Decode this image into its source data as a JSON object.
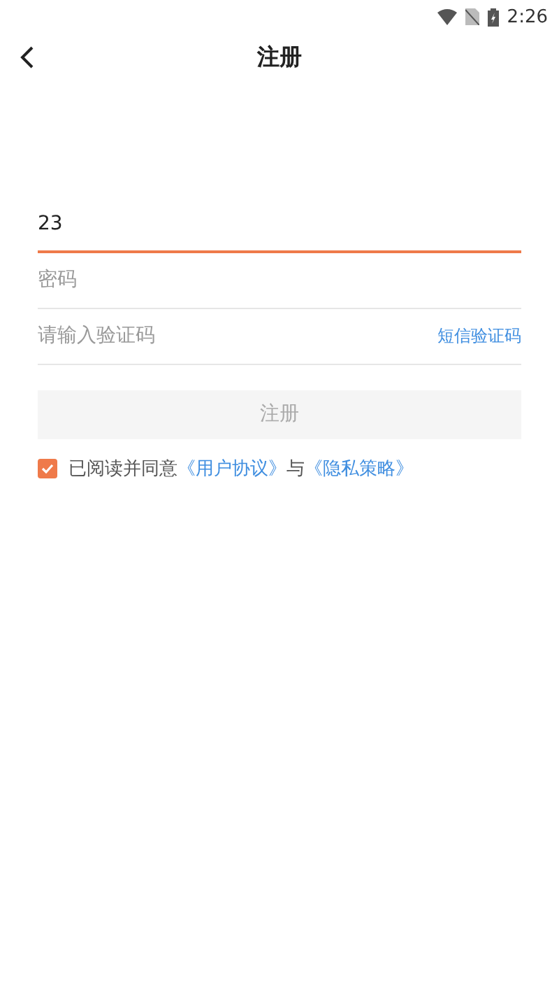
{
  "status_bar": {
    "time": "2:26"
  },
  "header": {
    "title": "注册"
  },
  "fields": [
    {
      "kind": "text",
      "value": "23",
      "focused": true
    },
    {
      "kind": "text",
      "placeholder": "密码",
      "focused": false
    },
    {
      "kind": "code",
      "placeholder": "请输入验证码",
      "focused": false,
      "action": "短信验证码"
    }
  ],
  "submit": {
    "label": "注册",
    "disabled": true
  },
  "agreement": {
    "checked": true,
    "prefix": "已阅读并同意",
    "link_1": "《用户协议》",
    "joiner": "与",
    "link_2": "《隐私策略》"
  }
}
